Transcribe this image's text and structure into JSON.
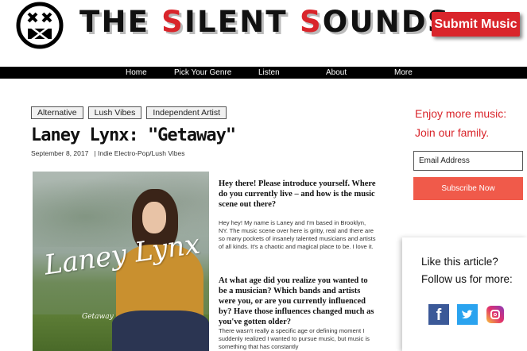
{
  "header": {
    "title_parts": [
      "THE ",
      "S",
      "ILENT ",
      "S",
      "OUNDS"
    ],
    "submit_label": "Submit Music"
  },
  "nav": {
    "items": [
      "Home",
      "Pick Your Genre",
      "Listen",
      "About",
      "More"
    ]
  },
  "post": {
    "tags": [
      "Alternative",
      "Lush Vibes",
      "Independent Artist"
    ],
    "title": "Laney Lynx: \"Getaway\"",
    "date": "September 8, 2017",
    "category": "|  Indie Electro-Pop/Lush Vibes",
    "album_art": {
      "artist_text": "Laney Lynx",
      "album_text": "Getaway"
    },
    "interview": [
      {
        "q": "Hey there! Please introduce yourself. Where do you currently live – and how is the music scene out there?",
        "a": "Hey hey! My name is Laney and I'm based in Brooklyn, NY. The music scene over here is gritty, real and there are so many pockets of insanely talented musicians and artists of all kinds. It's a chaotic and magical place to be. I love it."
      },
      {
        "q": "At what age did you realize you wanted to be a musician? Which bands and artists were you, or are you currently influenced by? Have those influences changed much as you've gotten older?",
        "a": "There wasn't really a specific age or defining moment I suddenly realized I wanted to pursue music, but music is something that has constantly"
      }
    ]
  },
  "sidebar": {
    "enjoy_line1": "Enjoy more music:",
    "enjoy_line2": "Join our family.",
    "email_placeholder": "Email Address",
    "subscribe_label": "Subscribe Now",
    "follow_line1": "Like this article?",
    "follow_line2": "Follow us for more:"
  },
  "colors": {
    "accent_red": "#d9252b",
    "subscribe": "#f05a4a",
    "facebook": "#3b5998",
    "twitter": "#2aa3ef"
  },
  "icons": [
    "silent-face-logo-icon",
    "facebook-icon",
    "twitter-icon",
    "instagram-icon"
  ]
}
